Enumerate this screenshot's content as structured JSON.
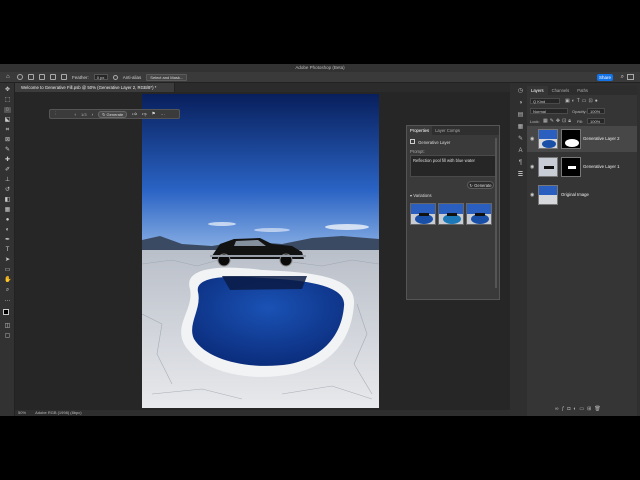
{
  "app": {
    "window_title": "Adobe Photoshop (Beta)",
    "share_label": "Share"
  },
  "options_bar": {
    "feather_label": "Feather:",
    "feather_value": "0 px",
    "antialias_label": "Anti-alias",
    "select_mask_label": "Select and Mask..."
  },
  "document": {
    "tab_title": "Welcome to Generative Fill.psb @ 50% (Generative Layer 2, RGB/8*) *",
    "zoom": "50%",
    "color_profile": "Adobe RGB (1998) (8bpc)"
  },
  "context_bar": {
    "counter": "1/3",
    "generate_label": "Generate"
  },
  "properties_panel": {
    "tab_properties": "Properties",
    "tab_layer_comps": "Layer Comps",
    "layer_type": "Generative Layer",
    "prompt_label": "Prompt:",
    "prompt_text": "Reflection pool fill with blue water",
    "generate_label": "Generate",
    "variations_label": "Variations"
  },
  "layers_panel": {
    "tab_layers": "Layers",
    "tab_channels": "Channels",
    "tab_paths": "Paths",
    "kind_filter": "Q Kind",
    "blend_mode": "Normal",
    "opacity_label": "Opacity:",
    "opacity_value": "100%",
    "lock_label": "Lock:",
    "fill_label": "Fill:",
    "fill_value": "100%",
    "layers": [
      {
        "name": "Generative Layer 2",
        "selected": true
      },
      {
        "name": "Generative Layer 1",
        "selected": false
      },
      {
        "name": "Original Image",
        "selected": false
      }
    ]
  },
  "colors": {
    "accent": "#1473e6",
    "sky_top": "#0a2a6e",
    "pool": "#1a4fa8"
  }
}
